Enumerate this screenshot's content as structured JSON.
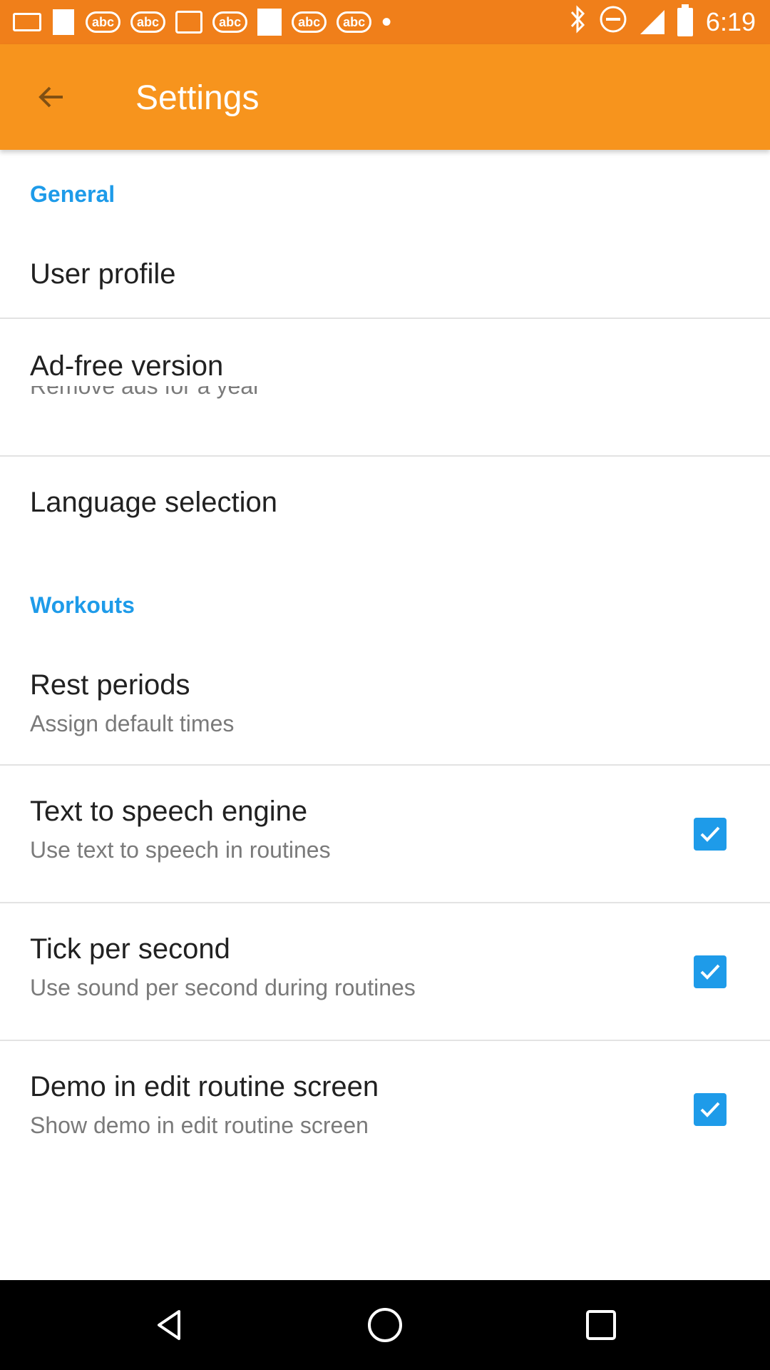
{
  "status_bar": {
    "time": "6:19",
    "notification_icons": [
      "mail-icon",
      "image-icon",
      "abc13-icon",
      "abc13-icon",
      "chat-icon",
      "abc13-icon",
      "square-icon",
      "abc13-icon",
      "abc13-icon",
      "dot-icon"
    ],
    "status_icons": [
      "bluetooth-icon",
      "minus-circle-icon",
      "signal-icon",
      "battery-icon"
    ]
  },
  "app_bar": {
    "title": "Settings",
    "back_icon": "arrow-left-icon",
    "color": "#f7941d"
  },
  "sections": [
    {
      "header": "General",
      "items": [
        {
          "title": "User profile"
        },
        {
          "title": "Ad-free version",
          "summary": "Remove ads for a year"
        },
        {
          "title": "Language selection"
        }
      ]
    },
    {
      "header": "Workouts",
      "items": [
        {
          "title": "Rest periods",
          "summary": "Assign default times"
        },
        {
          "title": "Text to speech engine",
          "summary": "Use text to speech in routines",
          "checked": true
        },
        {
          "title": "Tick per second",
          "summary": "Use sound per second during routines",
          "checked": true
        },
        {
          "title": "Demo in edit routine screen",
          "summary": "Show demo in edit routine screen",
          "checked": true
        }
      ]
    }
  ],
  "accent_color": "#1e9be9",
  "nav_bar": {
    "buttons": [
      "back-triangle-icon",
      "home-circle-icon",
      "recents-square-icon"
    ]
  }
}
